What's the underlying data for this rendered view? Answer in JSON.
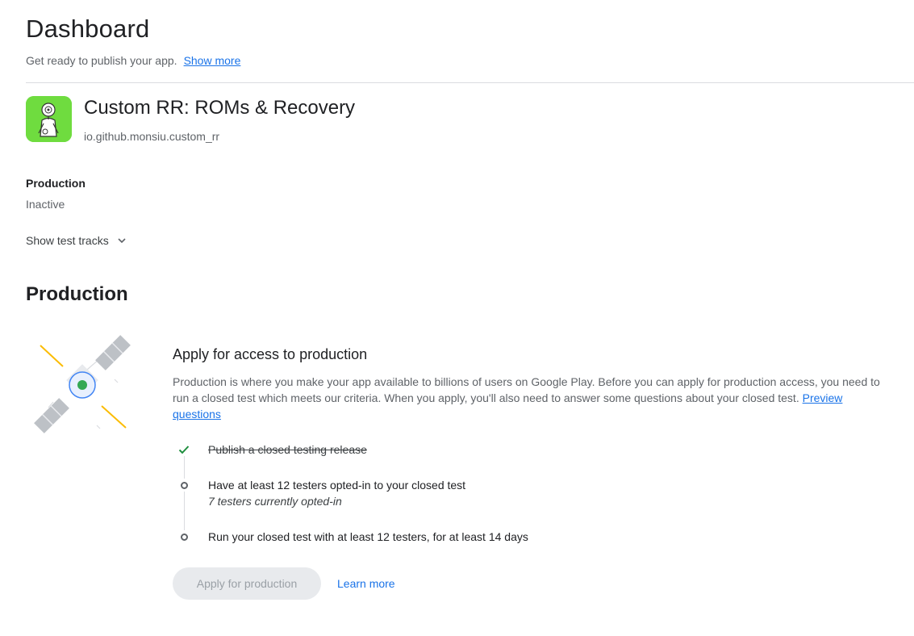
{
  "header": {
    "title": "Dashboard",
    "subtitle": "Get ready to publish your app.",
    "show_more": "Show more"
  },
  "app": {
    "name": "Custom RR: ROMs & Recovery",
    "package": "io.github.monsiu.custom_rr",
    "icon_bg": "#6fdc3f"
  },
  "track": {
    "label": "Production",
    "status": "Inactive",
    "toggle_label": "Show test tracks"
  },
  "production": {
    "section_title": "Production",
    "card_title": "Apply for access to production",
    "description": "Production is where you make your app available to billions of users on Google Play. Before you can apply for production access, you need to run a closed test which meets our criteria. When you apply, you'll also need to answer some questions about your closed test.",
    "preview_link": "Preview questions",
    "steps": [
      {
        "text": "Publish a closed testing release",
        "done": true
      },
      {
        "text": "Have at least 12 testers opted-in to your closed test",
        "sub": "7 testers currently opted-in",
        "done": false
      },
      {
        "text": "Run your closed test with at least 12 testers, for at least 14 days",
        "done": false
      }
    ],
    "apply_button": "Apply for production",
    "learn_more": "Learn more"
  },
  "colors": {
    "accent": "#1a73e8",
    "check": "#1e8e3e",
    "illustration_green": "#34a853",
    "illustration_yellow": "#fbbc04"
  }
}
